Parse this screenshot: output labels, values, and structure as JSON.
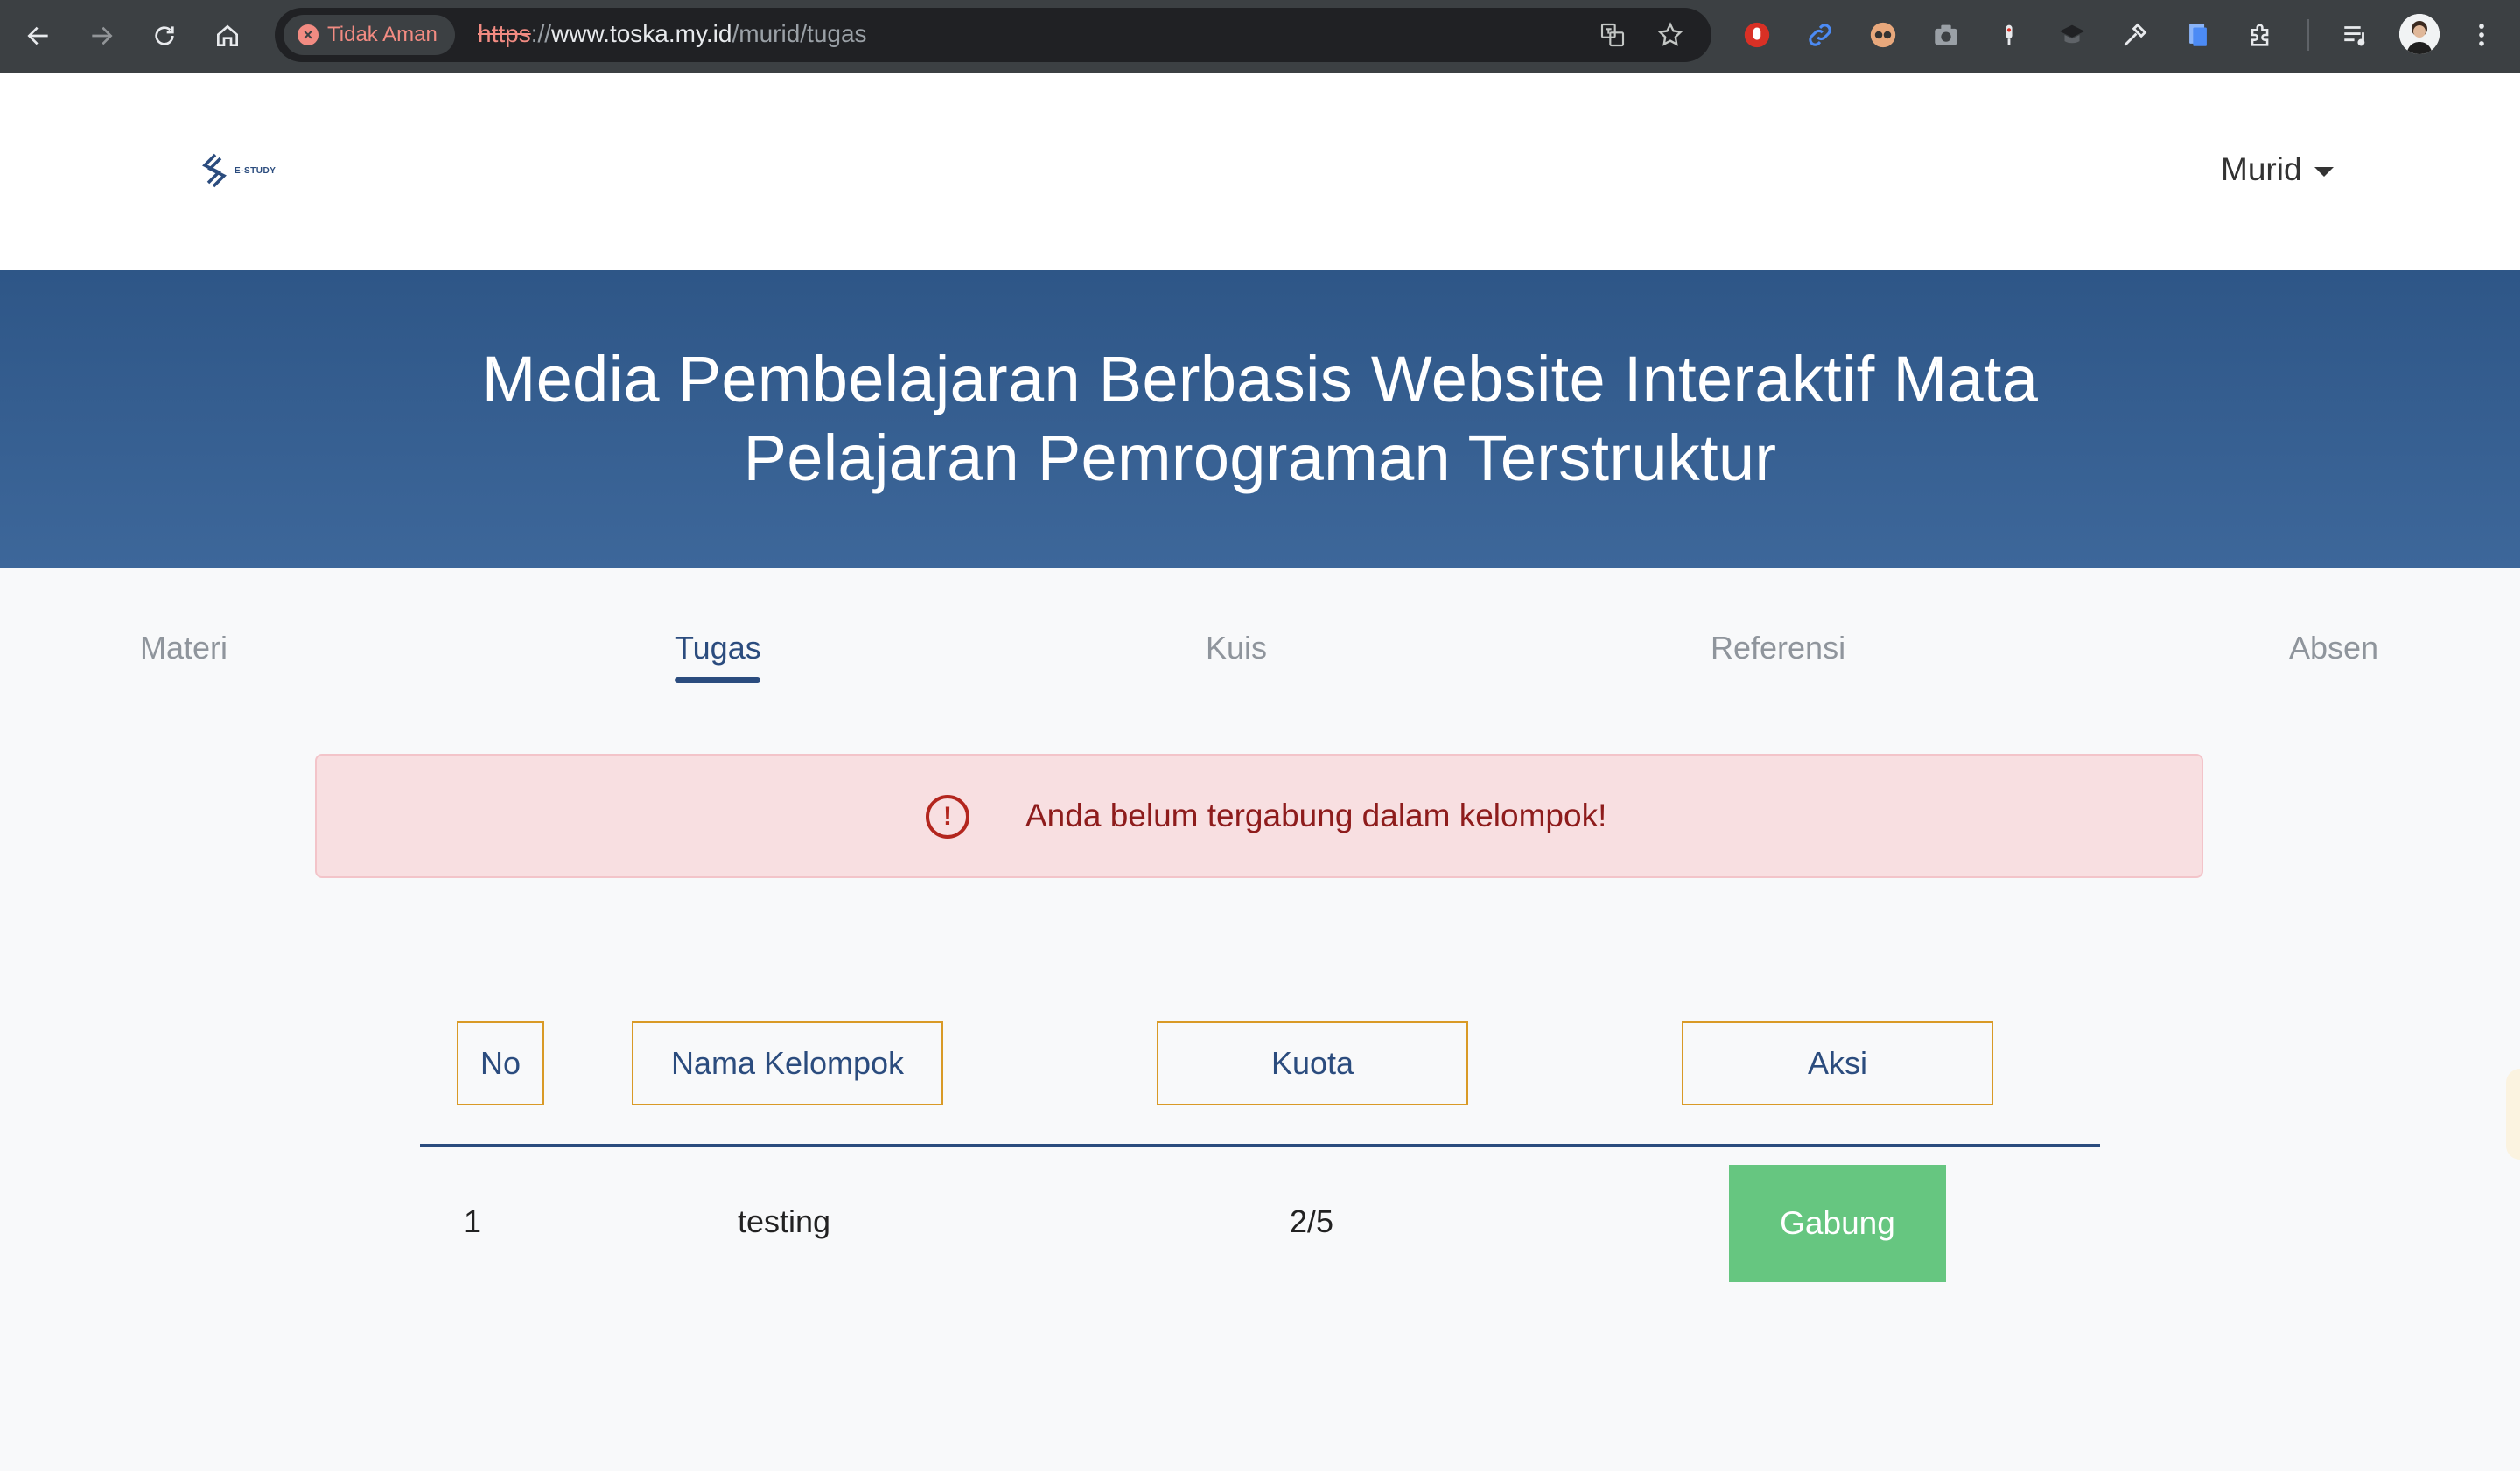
{
  "browser": {
    "security_label": "Tidak Aman",
    "url_scheme": "https",
    "url_sep": "://",
    "url_host": "www.toska.my.id",
    "url_path": "/murid/tugas"
  },
  "site": {
    "logo_text": "E-STUDY",
    "user_menu_label": "Murid",
    "hero_title": "Media Pembelajaran Berbasis Website Interaktif Mata Pelajaran Pemrograman Terstruktur"
  },
  "tabs": [
    {
      "label": "Materi",
      "active": false
    },
    {
      "label": "Tugas",
      "active": true
    },
    {
      "label": "Kuis",
      "active": false
    },
    {
      "label": "Referensi",
      "active": false
    },
    {
      "label": "Absen",
      "active": false
    }
  ],
  "alert": {
    "message": "Anda belum tergabung dalam kelompok!",
    "icon": "exclamation-circle-icon"
  },
  "table": {
    "headers": [
      "No",
      "Nama Kelompok",
      "Kuota",
      "Aksi"
    ],
    "rows": [
      {
        "no": "1",
        "name": "testing",
        "quota": "2/5",
        "action": "Gabung"
      }
    ]
  },
  "colors": {
    "primary": "#2b4c7e",
    "hero": "#345d91",
    "alert_bg": "#f8dfe1",
    "alert_text": "#8e1c1c",
    "header_border": "#d99a26",
    "join_button": "#66c680"
  }
}
